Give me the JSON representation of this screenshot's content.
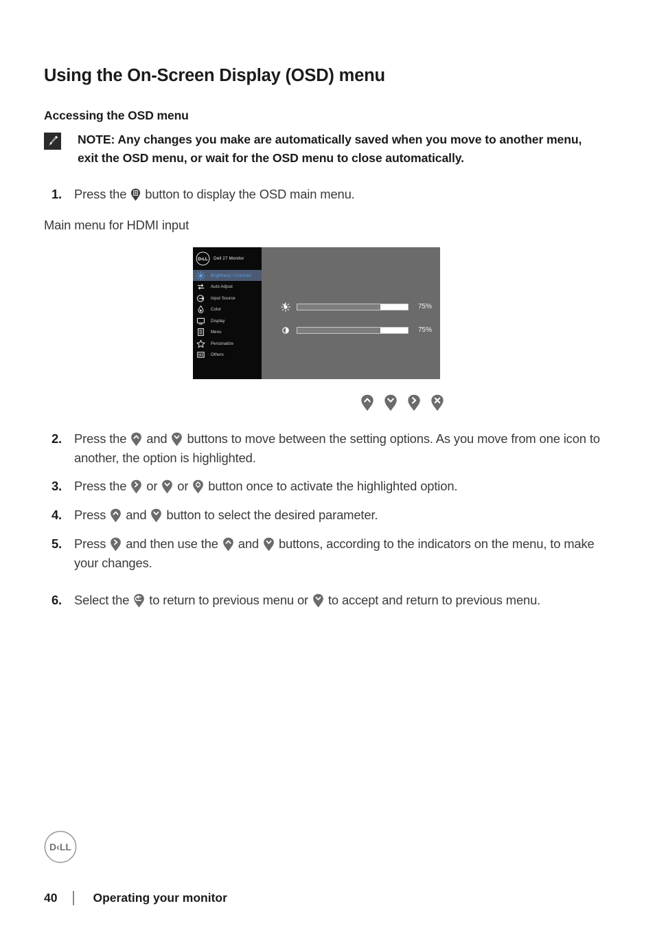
{
  "document": {
    "page_title": "Using the On-Screen Display (OSD) menu",
    "section_title": "Accessing the OSD menu",
    "note": {
      "icon": "note-pencil-icon",
      "text": "NOTE: Any changes you make are automatically saved when you move to another menu, exit the OSD menu, or wait for the OSD menu to close automatically."
    },
    "caption": "Main menu for HDMI input"
  },
  "steps": [
    {
      "num": "1.",
      "pre": "Press the",
      "icons": [
        "menu-pin-icon"
      ],
      "post": "button to display the OSD main menu.",
      "parts": [
        "Press the",
        "button to display the OSD main menu."
      ]
    },
    {
      "num": "2.",
      "parts": [
        "Press the",
        "and",
        "buttons to move between the setting options. As you move from one icon to another, the option is highlighted."
      ]
    },
    {
      "num": "3.",
      "parts": [
        "Press the",
        "or",
        "or",
        "button once to activate the highlighted option."
      ]
    },
    {
      "num": "4.",
      "parts": [
        "Press",
        "and",
        "button to select the desired parameter."
      ]
    },
    {
      "num": "5.",
      "parts": [
        "Press",
        "and then use the",
        "and",
        "buttons, according to the indicators on the menu, to make your changes."
      ]
    },
    {
      "num": "6.",
      "parts": [
        "Select the",
        "to return to previous menu or",
        "to accept and return to previous menu."
      ]
    }
  ],
  "osd": {
    "brand_name": "Dell 27 Monitor",
    "brand_logo": "dell-logo",
    "menu_items": [
      {
        "label": "Brightness / Contrast",
        "icon": "brightness-icon",
        "active": true
      },
      {
        "label": "Auto Adjust",
        "icon": "auto-adjust-icon",
        "active": false
      },
      {
        "label": "Input Source",
        "icon": "input-source-icon",
        "active": false
      },
      {
        "label": "Color",
        "icon": "color-drop-icon",
        "active": false
      },
      {
        "label": "Display",
        "icon": "display-monitor-icon",
        "active": false
      },
      {
        "label": "Menu",
        "icon": "menu-list-icon",
        "active": false
      },
      {
        "label": "Personalize",
        "icon": "star-icon",
        "active": false
      },
      {
        "label": "Others",
        "icon": "others-icon",
        "active": false
      }
    ],
    "sliders": [
      {
        "name": "brightness",
        "icon": "sun-icon",
        "value": "75%",
        "fill_percent": 75
      },
      {
        "name": "contrast",
        "icon": "contrast-icon",
        "value": "75%",
        "fill_percent": 75
      }
    ],
    "nav_buttons": [
      {
        "icon": "chevron-up-pin-icon"
      },
      {
        "icon": "chevron-down-pin-icon"
      },
      {
        "icon": "chevron-right-pin-icon"
      },
      {
        "icon": "close-x-pin-icon"
      }
    ],
    "highlight_color": "#4c5b73",
    "accent_color": "#5aa0e8",
    "panel_bg": "#6b6b6b",
    "sidebar_bg": "#0a0a0a"
  },
  "footer": {
    "logo": "dell-logo",
    "page_number": "40",
    "section": "Operating your monitor"
  }
}
